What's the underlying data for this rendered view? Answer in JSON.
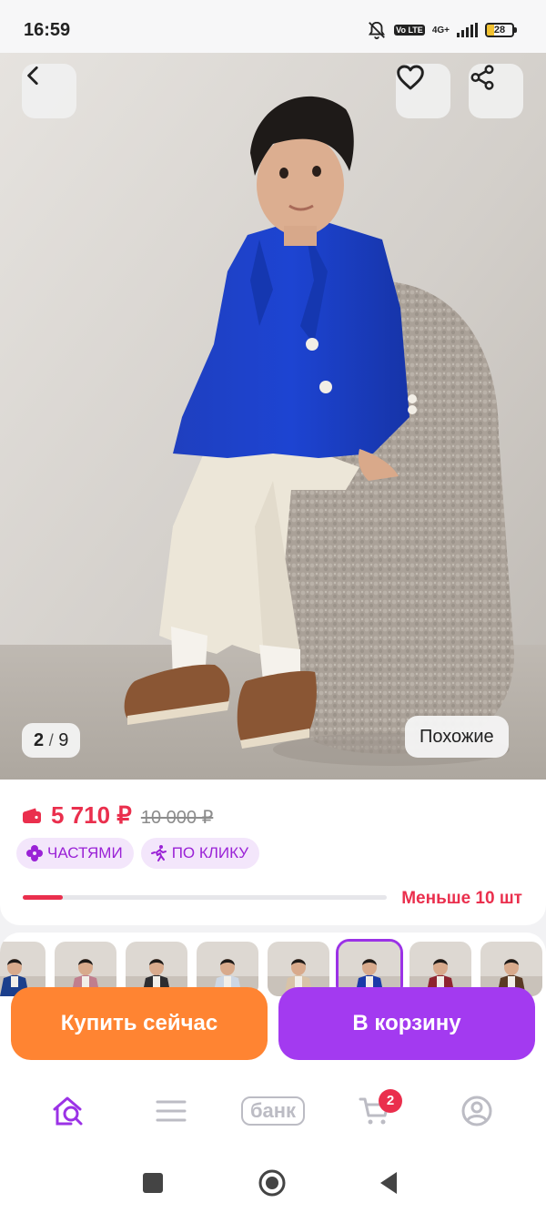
{
  "status_bar": {
    "time": "16:59",
    "network_type": "4G+",
    "volte_label": "Vo LTE",
    "battery_level": "28",
    "icons": [
      "bell-off-icon",
      "volte-icon",
      "signal-icon",
      "battery-icon"
    ]
  },
  "photo": {
    "counter_current": "2",
    "counter_separator": "/",
    "counter_total": "9",
    "similar_label": "Похожие",
    "icons": [
      "back-arrow-icon",
      "heart-icon",
      "share-icon"
    ]
  },
  "price": {
    "current": "5 710 ₽",
    "old": "10 000 ₽",
    "tags": [
      {
        "label": "ЧАСТЯМИ",
        "icon": "clover-icon"
      },
      {
        "label": "ПО КЛИКУ",
        "icon": "running-man-icon"
      }
    ],
    "stock_text": "Меньше 10 шт",
    "stock_fill_fraction": 0.11
  },
  "thumbnails": {
    "count": 8,
    "active_index": 5,
    "jacket_colors": [
      "#1b3f8c",
      "#c07e8e",
      "#2d2d30",
      "#cdd7e4",
      "#d8c3a8",
      "#1a3aa8",
      "#8e2430",
      "#5a3a24"
    ]
  },
  "actions": {
    "buy_now": "Купить сейчас",
    "add_to_cart": "В корзину"
  },
  "bottom_nav": {
    "bank_label": "банк",
    "cart_count": "2",
    "icons": [
      "home-search-icon",
      "catalog-icon",
      "bank-icon",
      "cart-icon",
      "profile-icon"
    ]
  },
  "colors": {
    "accent_purple": "#a33af0",
    "accent_orange": "#ff8432",
    "price_red": "#ea2f4d",
    "tag_bg": "#f3e6fb"
  }
}
